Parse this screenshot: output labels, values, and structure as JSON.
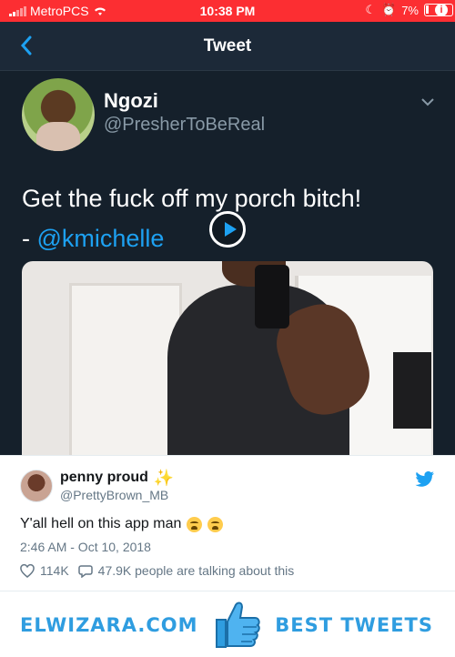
{
  "status_bar": {
    "carrier": "MetroPCS",
    "time": "10:38 PM",
    "battery": "7%"
  },
  "nav": {
    "title": "Tweet"
  },
  "original_tweet": {
    "name": "Ngozi",
    "handle": "@PresherToBeReal",
    "text_line1": "Get the fuck off my porch bitch!",
    "text_dash": "- ",
    "mention": "@kmichelle"
  },
  "reply_card": {
    "name": "penny proud",
    "name_emoji": "✨",
    "handle": "@PrettyBrown_MB",
    "text": "Y'all hell on this app man",
    "emoji_count": 2,
    "timestamp": "2:46 AM - Oct 10, 2018",
    "likes": "114K",
    "talking": "47.9K people are talking about this"
  },
  "footer": {
    "brand": "ELWIZARA.COM",
    "tagline": "BEST TWEETS"
  },
  "colors": {
    "status_bar": "#fc2e32",
    "twitter_blue": "#1da1f2",
    "dark_bg": "#15202b",
    "brand_blue": "#2f9de0"
  },
  "icons": {
    "back": "chevron-left-icon",
    "more": "chevron-down-icon",
    "play": "play-icon",
    "bird": "twitter-bird-icon",
    "like": "heart-icon",
    "reply": "comment-icon",
    "thumbs_up": "thumbs-up-icon"
  }
}
